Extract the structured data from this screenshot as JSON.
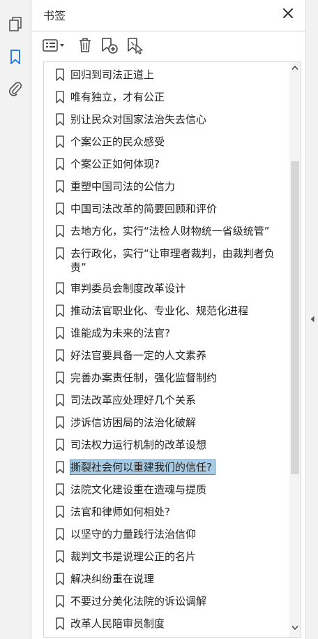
{
  "panel": {
    "title": "书签"
  },
  "colors": {
    "accent": "#1473e6",
    "selection": "#a9cbe3"
  },
  "toolbar": {
    "options_icon": "list-options-icon",
    "delete_icon": "trash-icon",
    "new_bookmark_icon": "add-bookmark-icon",
    "bookmark_from_selection_icon": "bookmark-cursor-icon"
  },
  "bookmarks": [
    {
      "label": "回归到司法正道上"
    },
    {
      "label": "唯有独立，才有公正"
    },
    {
      "label": "别让民众对国家法治失去信心"
    },
    {
      "label": "个案公正的民众感受"
    },
    {
      "label": "个案公正如何体现?"
    },
    {
      "label": "重塑中国司法的公信力"
    },
    {
      "label": "中国司法改革的简要回顾和评价"
    },
    {
      "label": "去地方化，实行“法检人财物统一省级统管”"
    },
    {
      "label": "去行政化，实行“让审理者裁判，由裁判者负责”"
    },
    {
      "label": "审判委员会制度改革设计"
    },
    {
      "label": "推动法官职业化、专业化、规范化进程"
    },
    {
      "label": "谁能成为未来的法官?"
    },
    {
      "label": "好法官要具备一定的人文素养"
    },
    {
      "label": "完善办案责任制，强化监督制约"
    },
    {
      "label": "司法改革应处理好几个关系"
    },
    {
      "label": "涉诉信访困局的法治化破解"
    },
    {
      "label": "司法权力运行机制的改革设想"
    },
    {
      "label": "撕裂社会何以重建我们的信任?"
    },
    {
      "label": "法院文化建设重在造魂与提质"
    },
    {
      "label": "法官和律师如何相处?"
    },
    {
      "label": "以坚守的力量践行法治信仰"
    },
    {
      "label": "裁判文书是说理公正的名片"
    },
    {
      "label": "解决纠纷重在说理"
    },
    {
      "label": "不要过分美化法院的诉讼调解"
    },
    {
      "label": "改革人民陪审员制度"
    }
  ]
}
